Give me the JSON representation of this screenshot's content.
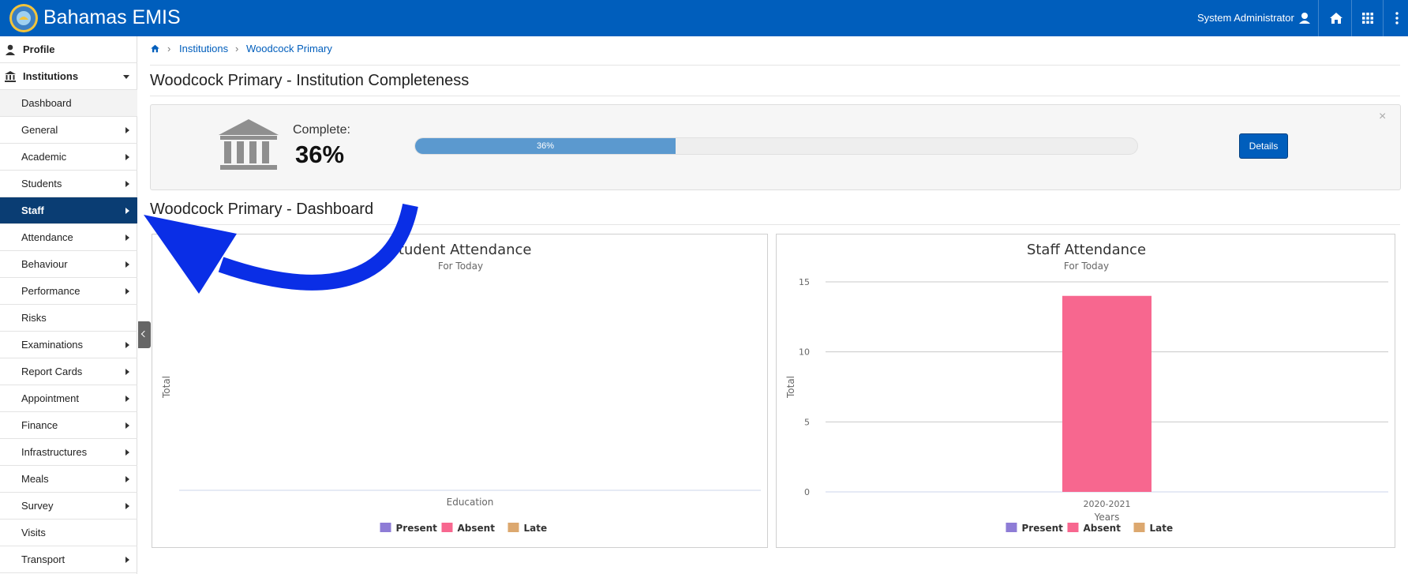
{
  "header": {
    "brand": "Bahamas EMIS",
    "user": "System Administrator",
    "colors": {
      "bar": "#005ebc"
    },
    "icons": [
      "user-icon",
      "home-icon",
      "apps-grid-icon",
      "more-vertical-icon"
    ]
  },
  "sidebar": {
    "items": [
      {
        "label": "Profile",
        "icon": "user-icon"
      },
      {
        "label": "Institutions",
        "icon": "bank-icon"
      },
      {
        "label": "Dashboard"
      },
      {
        "label": "General"
      },
      {
        "label": "Academic"
      },
      {
        "label": "Students"
      },
      {
        "label": "Staff"
      },
      {
        "label": "Attendance"
      },
      {
        "label": "Behaviour"
      },
      {
        "label": "Performance"
      },
      {
        "label": "Risks"
      },
      {
        "label": "Examinations"
      },
      {
        "label": "Report Cards"
      },
      {
        "label": "Appointment"
      },
      {
        "label": "Finance"
      },
      {
        "label": "Infrastructures"
      },
      {
        "label": "Meals"
      },
      {
        "label": "Survey"
      },
      {
        "label": "Visits"
      },
      {
        "label": "Transport"
      }
    ],
    "active": "Staff",
    "active_color": "#0a3d73"
  },
  "breadcrumb": [
    "Institutions",
    "Woodcock Primary"
  ],
  "completeness": {
    "title": "Woodcock Primary - Institution Completeness",
    "label": "Complete:",
    "value": "36%",
    "progress_percent": 36,
    "progress_label": "36%",
    "details_label": "Details",
    "close_label": "×"
  },
  "dashboard": {
    "title": "Woodcock Primary - Dashboard"
  },
  "chart_data": [
    {
      "type": "bar",
      "title": "Student Attendance",
      "subtitle": "For Today",
      "xlabel": "Education",
      "ylabel": "Total",
      "categories": [],
      "series": [
        {
          "name": "Present",
          "color": "#8e7cd6",
          "values": []
        },
        {
          "name": "Absent",
          "color": "#f7678f",
          "values": []
        },
        {
          "name": "Late",
          "color": "#dca86f",
          "values": []
        }
      ],
      "grid": true,
      "legend": "bottom-center"
    },
    {
      "type": "bar",
      "title": "Staff Attendance",
      "subtitle": "For Today",
      "xlabel": "Years",
      "ylabel": "Total",
      "categories": [
        "2020-2021"
      ],
      "ylim": [
        0,
        15
      ],
      "yticks": [
        0,
        5,
        10,
        15
      ],
      "series": [
        {
          "name": "Present",
          "color": "#8e7cd6",
          "values": [
            0
          ]
        },
        {
          "name": "Absent",
          "color": "#f7678f",
          "values": [
            14
          ]
        },
        {
          "name": "Late",
          "color": "#dca86f",
          "values": [
            0
          ]
        }
      ],
      "grid": true,
      "legend": "bottom-center"
    }
  ]
}
